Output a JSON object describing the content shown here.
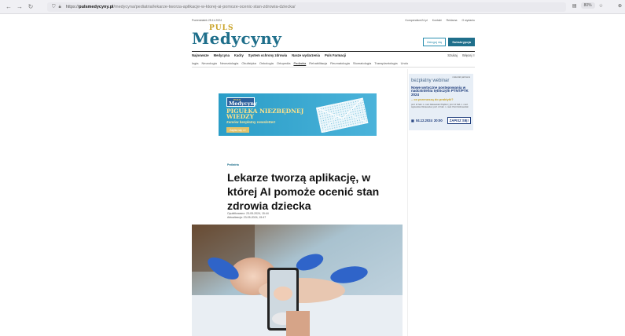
{
  "browser": {
    "url_domain": "pulsmedycyny.pl",
    "url_rest": "/medycyna/pediatria/lekarze-tworza-aplikacje-w-ktorej-ai-pomoze-ocenic-stan-zdrowia-dziecka/",
    "url_scheme": "https://",
    "zoom": "80%"
  },
  "header": {
    "date": "Poniedziałek 25.11.2024",
    "top_links": [
      "Kompendium24.pl",
      "Kontakt",
      "Reklama",
      "O wydaniu"
    ],
    "logo_top": "PULS",
    "logo_main": "Medycyny",
    "login_label": "Zaloguj się",
    "subscribe_label": "Subskrypcja"
  },
  "main_nav": {
    "items": [
      "Najnowsze",
      "Medycyna",
      "Kadry",
      "System ochrony zdrowia",
      "Nasze wydarzenia",
      "Puls Farmacji"
    ],
    "search": "Szukaj",
    "newsletter": "Więcej ≡"
  },
  "sub_nav": {
    "items": [
      "logia",
      "Neurologia",
      "Neonatologia",
      "Okulistyka",
      "Onkologia",
      "Ortopedia",
      "Pediatria",
      "Rehabilitacja",
      "Reumatologia",
      "Stomatologia",
      "Transplantologia",
      "Urolo"
    ],
    "active": "Pediatria"
  },
  "banner": {
    "logo_top": "PULS",
    "logo_main": "Medycyny",
    "headline": "PIGUŁKA NIEZBĘDNEJ WIEDZY",
    "subtext": "Zamów bezpłatny newsletter!",
    "button": "Zapisz się >>"
  },
  "article": {
    "category": "Pediatria",
    "headline": "Lekarze tworzą aplikację, w której AI pomoże ocenić stan zdrowia dziecka",
    "published": "Opublikowano: 23-05-2024, 15:44",
    "updated": "Aktualizacja: 23-05-2024, 15:47"
  },
  "webinar": {
    "partner": "materiał partnera",
    "label": "bezpłatny webinar",
    "title": "Nowe wytyczne postępowania w nadciśnieniu tętniczym PTNT/PTK 2024",
    "question": "– co przenoszą do praktyki?",
    "authors": "prof. dr hab. n. med. Aleksander Prejbisz | prof. dr hab. n. med. Agnieszka Olszanecka | prof. dr hab. n. med. Piotr Dobrowolski",
    "date": "04.12.2024",
    "time": "20:00",
    "cta": "ZAPISZ SIĘ!"
  },
  "colors": {
    "brand": "#1f6f8b",
    "gold": "#c9a227",
    "banner_blue": "#2a9dc7",
    "webinar_bg": "#e7eef6"
  }
}
